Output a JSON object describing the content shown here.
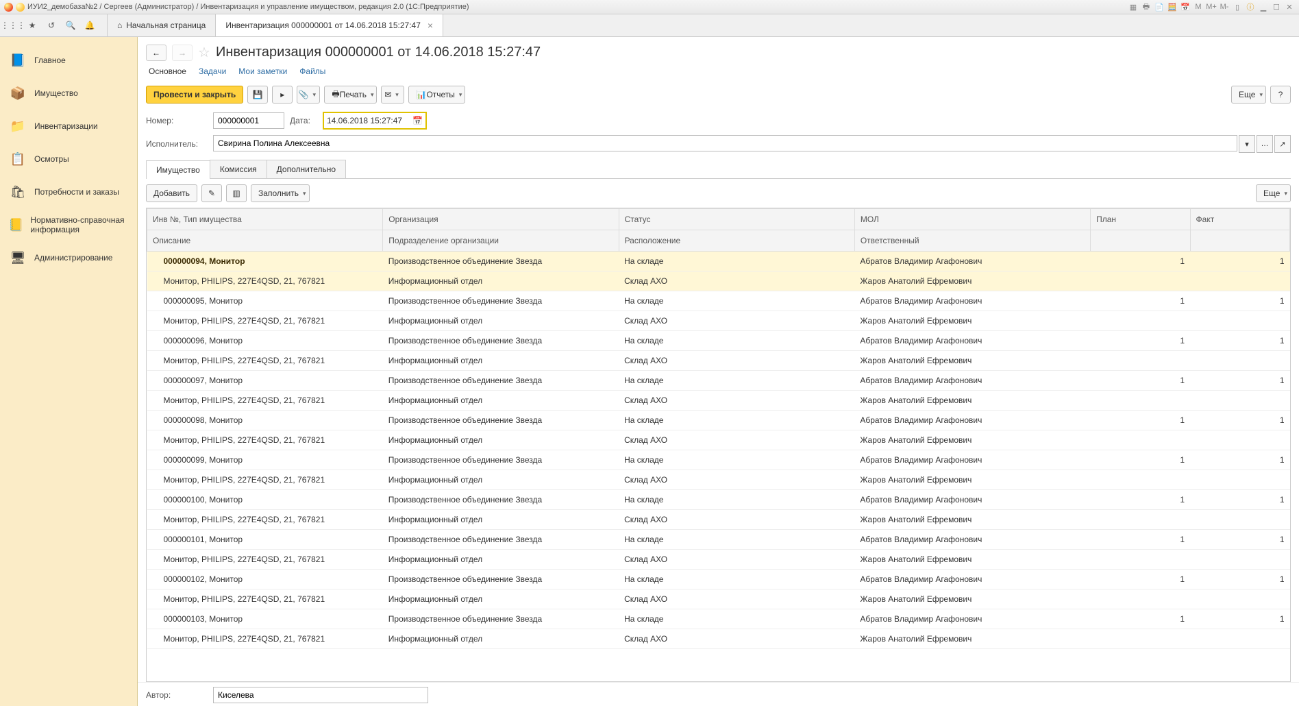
{
  "window_title": "ИУИ2_демобаза№2 / Сергеев (Администратор) / Инвентаризация и управление имуществом, редакция 2.0  (1С:Предприятие)",
  "tabs": {
    "home": "Начальная страница",
    "doc": "Инвентаризация 000000001 от 14.06.2018 15:27:47"
  },
  "sidebar": [
    {
      "label": "Главное",
      "icon": "📘"
    },
    {
      "label": "Имущество",
      "icon": "📦"
    },
    {
      "label": "Инвентаризации",
      "icon": "📁"
    },
    {
      "label": "Осмотры",
      "icon": "📋"
    },
    {
      "label": "Потребности и заказы",
      "icon": "🛍"
    },
    {
      "label": "Нормативно-справочная информация",
      "icon": "📒"
    },
    {
      "label": "Администрирование",
      "icon": "🖥"
    }
  ],
  "page_title": "Инвентаризация 000000001 от 14.06.2018 15:27:47",
  "subnav": [
    "Основное",
    "Задачи",
    "Мои заметки",
    "Файлы"
  ],
  "buttons": {
    "main": "Провести и закрыть",
    "print": "Печать",
    "reports": "Отчеты",
    "more": "Еще",
    "add": "Добавить",
    "fill": "Заполнить"
  },
  "form": {
    "number_label": "Номер:",
    "number": "000000001",
    "date_label": "Дата:",
    "date": "14.06.2018 15:27:47",
    "executor_label": "Исполнитель:",
    "executor": "Свирина Полина Алексеевна",
    "author_label": "Автор:",
    "author": "Киселева"
  },
  "inner_tabs": [
    "Имущество",
    "Комиссия",
    "Дополнительно"
  ],
  "headers": {
    "inv": "Инв №, Тип имущества",
    "org": "Организация",
    "status": "Статус",
    "mol": "МОЛ",
    "plan": "План",
    "fact": "Факт",
    "desc": "Описание",
    "dept": "Подразделение организации",
    "loc": "Расположение",
    "resp": "Ответственный"
  },
  "common": {
    "desc": "Монитор, PHILIPS, 227E4QSD, 21, 767821",
    "org": "Производственное объединение Звезда",
    "dept": "Информационный отдел",
    "status": "На складе",
    "loc": "Склад АХО",
    "mol": "Абратов Владимир Агафонович",
    "resp": "Жаров Анатолий Ефремович"
  },
  "rows": [
    {
      "inv": "000000094, Монитор",
      "plan": "1",
      "fact": "1",
      "sel": true
    },
    {
      "inv": "000000095, Монитор",
      "plan": "1",
      "fact": "1"
    },
    {
      "inv": "000000096, Монитор",
      "plan": "1",
      "fact": "1"
    },
    {
      "inv": "000000097, Монитор",
      "plan": "1",
      "fact": "1"
    },
    {
      "inv": "000000098, Монитор",
      "plan": "1",
      "fact": "1"
    },
    {
      "inv": "000000099, Монитор",
      "plan": "1",
      "fact": "1"
    },
    {
      "inv": "000000100, Монитор",
      "plan": "1",
      "fact": "1"
    },
    {
      "inv": "000000101, Монитор",
      "plan": "1",
      "fact": "1"
    },
    {
      "inv": "000000102, Монитор",
      "plan": "1",
      "fact": "1"
    },
    {
      "inv": "000000103, Монитор",
      "plan": "1",
      "fact": "1"
    }
  ]
}
